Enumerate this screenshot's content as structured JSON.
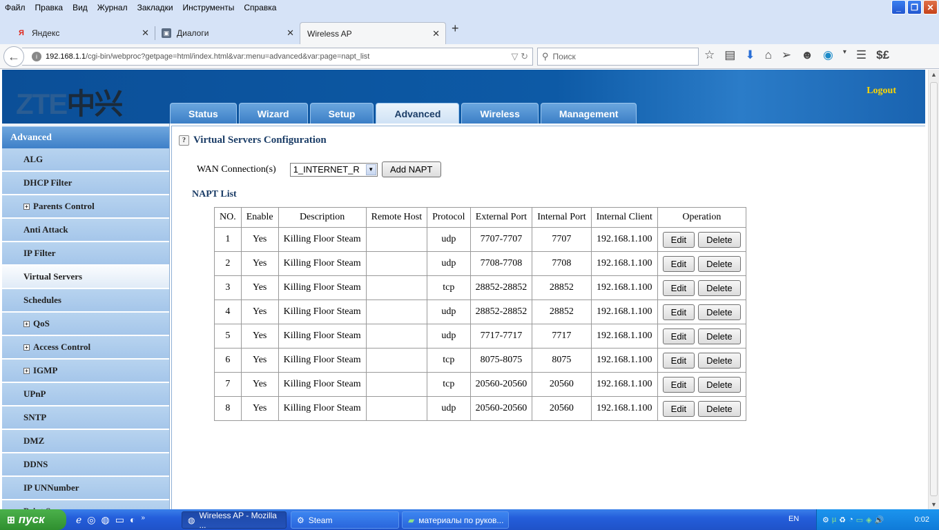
{
  "browser": {
    "menu": [
      "Файл",
      "Правка",
      "Вид",
      "Журнал",
      "Закладки",
      "Инструменты",
      "Справка"
    ],
    "tabs": [
      {
        "label": "Яндекс",
        "icon": "yandex-icon"
      },
      {
        "label": "Диалоги",
        "icon": "dialogs-icon"
      },
      {
        "label": "Wireless AP",
        "icon": ""
      }
    ],
    "url_host": "192.168.1.1",
    "url_path": "/cgi-bin/webproc?getpage=html/index.html&var:menu=advanced&var:page=napt_list",
    "search_placeholder": "Поиск"
  },
  "router": {
    "logo": "ZTE",
    "logo_cn": "中兴",
    "logout": "Logout",
    "nav": [
      "Status",
      "Wizard",
      "Setup",
      "Advanced",
      "Wireless",
      "Management"
    ],
    "nav_active": "Advanced",
    "sidebar_title": "Advanced",
    "sidebar": [
      {
        "label": "ALG",
        "plus": false
      },
      {
        "label": "DHCP Filter",
        "plus": false
      },
      {
        "label": "Parents Control",
        "plus": true
      },
      {
        "label": "Anti Attack",
        "plus": false
      },
      {
        "label": "IP Filter",
        "plus": false
      },
      {
        "label": "Virtual Servers",
        "plus": false,
        "selected": true
      },
      {
        "label": "Schedules",
        "plus": false
      },
      {
        "label": "QoS",
        "plus": true
      },
      {
        "label": "Access Control",
        "plus": true
      },
      {
        "label": "IGMP",
        "plus": true
      },
      {
        "label": "UPnP",
        "plus": false
      },
      {
        "label": "SNTP",
        "plus": false
      },
      {
        "label": "DMZ",
        "plus": false
      },
      {
        "label": "DDNS",
        "plus": false
      },
      {
        "label": "IP UNNumber",
        "plus": false
      },
      {
        "label": "Print Server",
        "plus": false
      }
    ],
    "page_title": "Virtual Servers Configuration",
    "help_icon": "?",
    "wan_label": "WAN Connection(s)",
    "wan_value": "1_INTERNET_R",
    "add_napt": "Add NAPT",
    "napt_list_label": "NAPT List",
    "table_headers": [
      "NO.",
      "Enable",
      "Description",
      "Remote Host",
      "Protocol",
      "External Port",
      "Internal Port",
      "Internal Client",
      "Operation"
    ],
    "edit_label": "Edit",
    "delete_label": "Delete",
    "rows": [
      [
        "1",
        "Yes",
        "Killing Floor Steam",
        "",
        "udp",
        "7707-7707",
        "7707",
        "192.168.1.100"
      ],
      [
        "2",
        "Yes",
        "Killing Floor Steam",
        "",
        "udp",
        "7708-7708",
        "7708",
        "192.168.1.100"
      ],
      [
        "3",
        "Yes",
        "Killing Floor Steam",
        "",
        "tcp",
        "28852-28852",
        "28852",
        "192.168.1.100"
      ],
      [
        "4",
        "Yes",
        "Killing Floor Steam",
        "",
        "udp",
        "28852-28852",
        "28852",
        "192.168.1.100"
      ],
      [
        "5",
        "Yes",
        "Killing Floor Steam",
        "",
        "udp",
        "7717-7717",
        "7717",
        "192.168.1.100"
      ],
      [
        "6",
        "Yes",
        "Killing Floor Steam",
        "",
        "tcp",
        "8075-8075",
        "8075",
        "192.168.1.100"
      ],
      [
        "7",
        "Yes",
        "Killing Floor Steam",
        "",
        "tcp",
        "20560-20560",
        "20560",
        "192.168.1.100"
      ],
      [
        "8",
        "Yes",
        "Killing Floor Steam",
        "",
        "udp",
        "20560-20560",
        "20560",
        "192.168.1.100"
      ]
    ]
  },
  "taskbar": {
    "start": "пуск",
    "windows": [
      {
        "label": "Wireless AP - Mozilla ...",
        "active": true
      },
      {
        "label": "Steam",
        "active": false
      },
      {
        "label": "материалы по руков...",
        "active": false
      }
    ],
    "lang": "EN",
    "clock": "0:02"
  }
}
